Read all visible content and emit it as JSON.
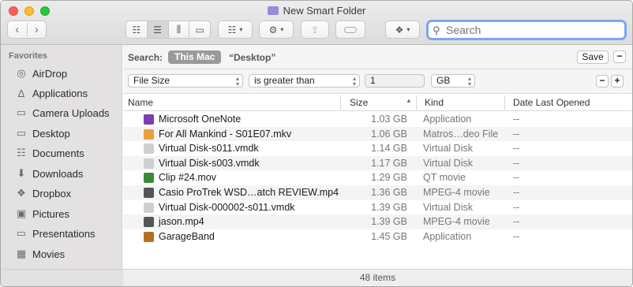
{
  "window": {
    "title": "New Smart Folder"
  },
  "toolbar": {
    "back_icon": "chevron-left-icon",
    "forward_icon": "chevron-right-icon",
    "search_placeholder": "Search"
  },
  "sidebar": {
    "heading": "Favorites",
    "items": [
      {
        "label": "AirDrop",
        "icon": "airdrop-icon"
      },
      {
        "label": "Applications",
        "icon": "applications-icon"
      },
      {
        "label": "Camera Uploads",
        "icon": "folder-icon"
      },
      {
        "label": "Desktop",
        "icon": "folder-icon"
      },
      {
        "label": "Documents",
        "icon": "document-icon"
      },
      {
        "label": "Downloads",
        "icon": "download-icon"
      },
      {
        "label": "Dropbox",
        "icon": "dropbox-icon"
      },
      {
        "label": "Pictures",
        "icon": "camera-icon"
      },
      {
        "label": "Presentations",
        "icon": "folder-icon"
      },
      {
        "label": "Movies",
        "icon": "film-icon"
      }
    ]
  },
  "search_scope": {
    "label": "Search:",
    "this_mac": "This Mac",
    "desktop": "“Desktop”",
    "save": "Save"
  },
  "criteria": {
    "attribute": "File Size",
    "operator": "is greater than",
    "value": "1",
    "unit": "GB"
  },
  "table": {
    "columns": {
      "name": "Name",
      "size": "Size",
      "kind": "Kind",
      "date": "Date Last Opened"
    },
    "rows": [
      {
        "name": "Microsoft OneNote",
        "size": "1.03 GB",
        "kind": "Application",
        "date": "--",
        "color": "#7b3fb3"
      },
      {
        "name": "For All Mankind - S01E07.mkv",
        "size": "1.06 GB",
        "kind": "Matros…deo File",
        "date": "--",
        "color": "#e8a03b"
      },
      {
        "name": "Virtual Disk-s011.vmdk",
        "size": "1.14 GB",
        "kind": "Virtual Disk",
        "date": "--",
        "color": "#cfcfcf"
      },
      {
        "name": "Virtual Disk-s003.vmdk",
        "size": "1.17 GB",
        "kind": "Virtual Disk",
        "date": "--",
        "color": "#cfcfcf"
      },
      {
        "name": "Clip #24.mov",
        "size": "1.29 GB",
        "kind": "QT movie",
        "date": "--",
        "color": "#3a8a3a"
      },
      {
        "name": "Casio ProTrek WSD…atch REVIEW.mp4",
        "size": "1.36 GB",
        "kind": "MPEG-4 movie",
        "date": "--",
        "color": "#555555"
      },
      {
        "name": "Virtual Disk-000002-s011.vmdk",
        "size": "1.39 GB",
        "kind": "Virtual Disk",
        "date": "--",
        "color": "#cfcfcf"
      },
      {
        "name": "jason.mp4",
        "size": "1.39 GB",
        "kind": "MPEG-4 movie",
        "date": "--",
        "color": "#555555"
      },
      {
        "name": "GarageBand",
        "size": "1.45 GB",
        "kind": "Application",
        "date": "--",
        "color": "#b5711f"
      }
    ]
  },
  "status": {
    "count": "48 items"
  }
}
